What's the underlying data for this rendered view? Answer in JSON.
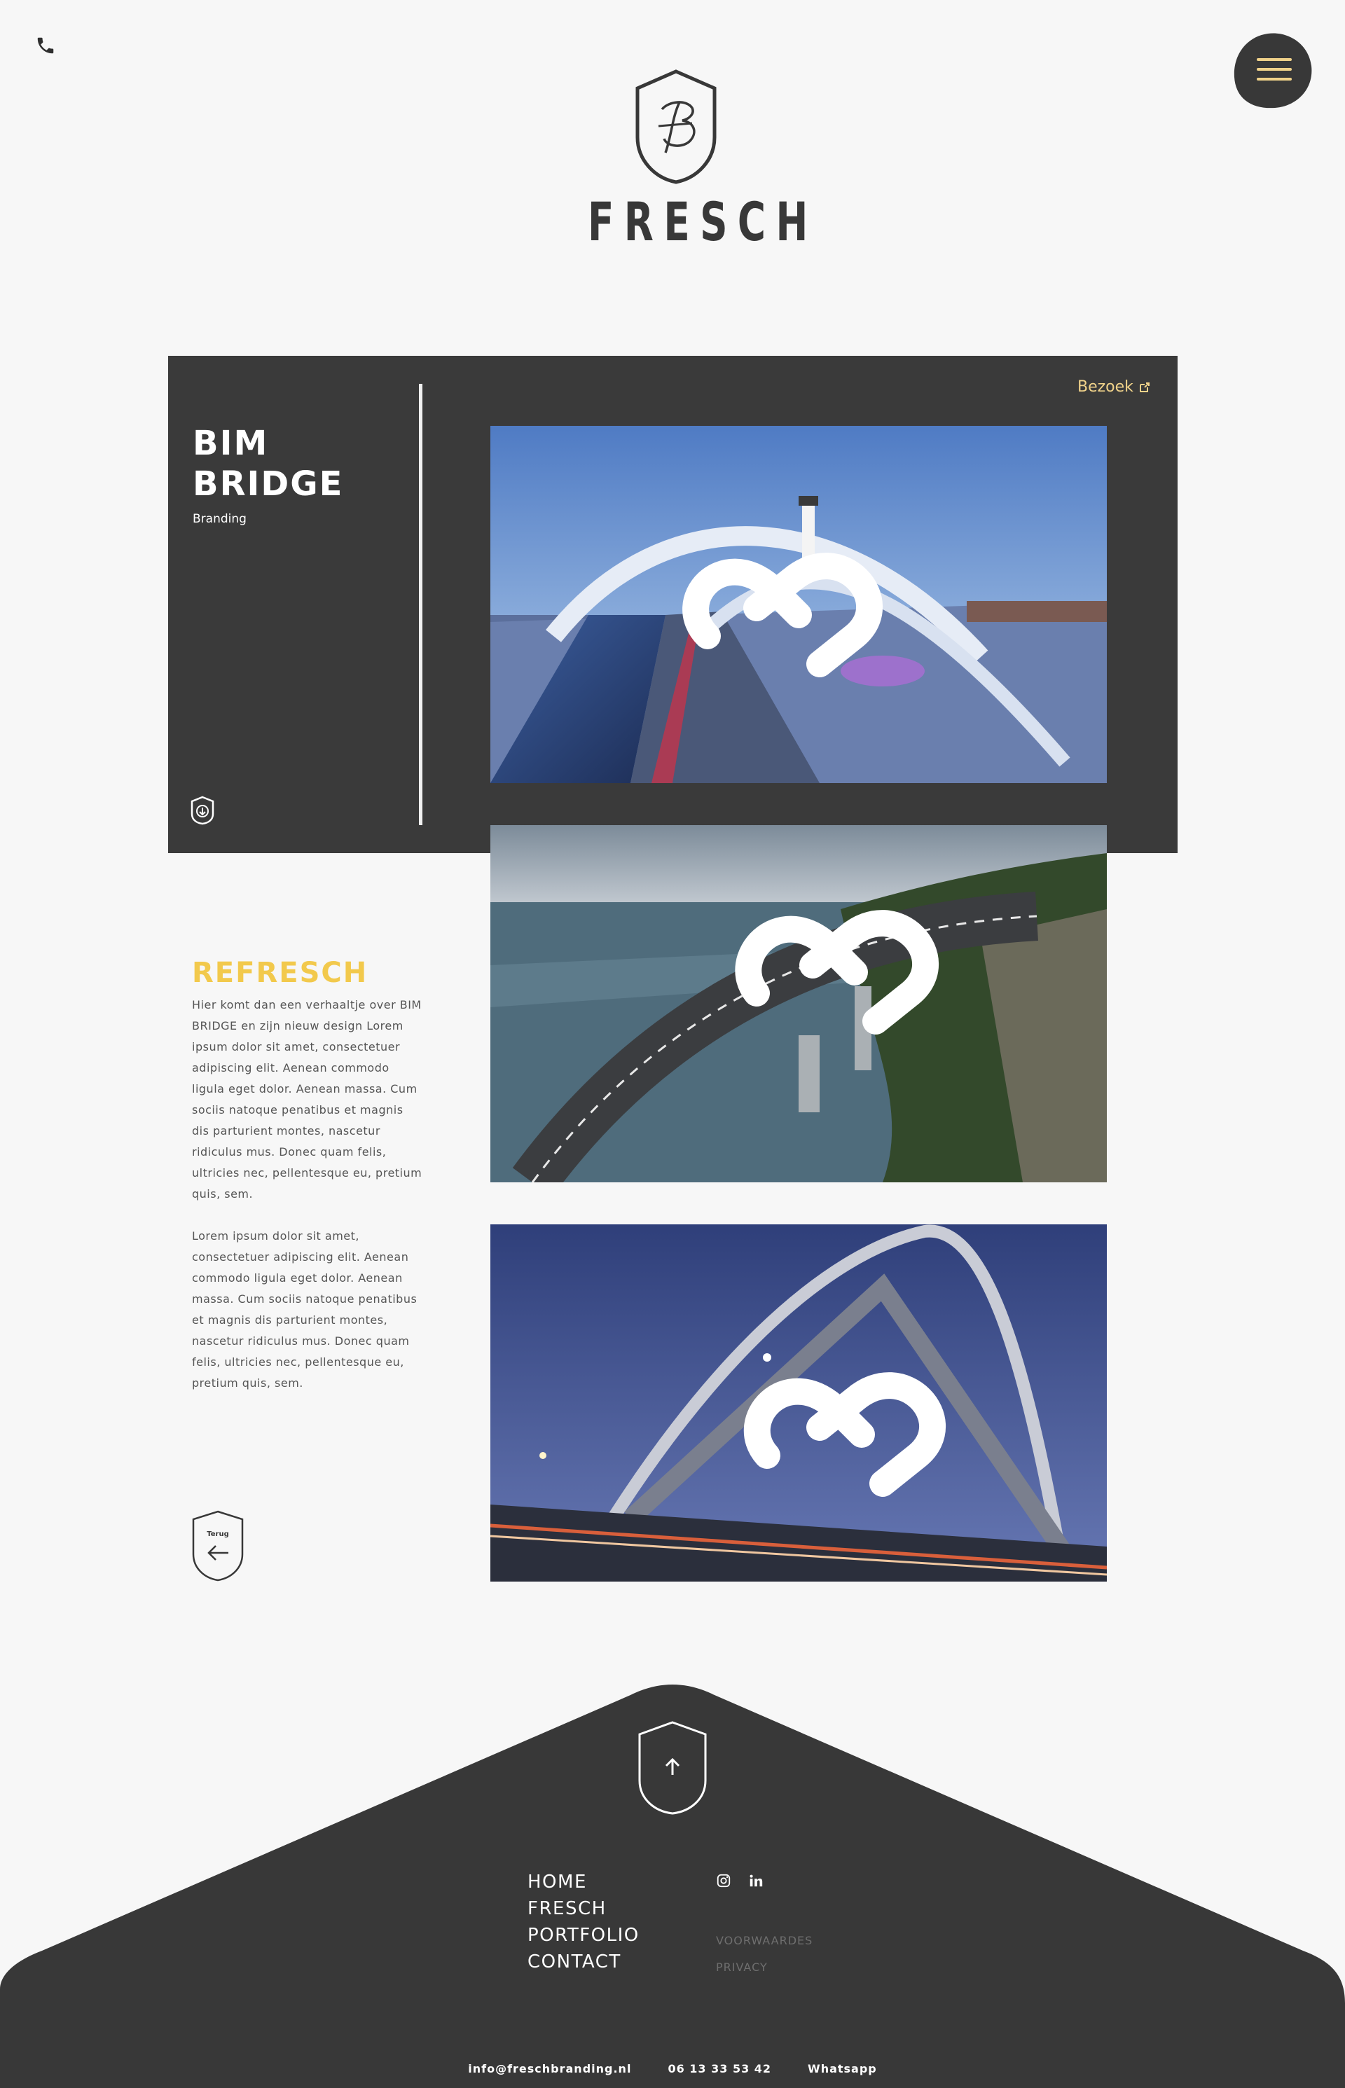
{
  "header": {
    "phone_icon": "phone-icon",
    "menu_icon": "hamburger-icon",
    "brand_monogram": "FB",
    "brand_name": "FRESCH"
  },
  "project": {
    "title_line1": "BIM",
    "title_line2": "BRIDGE",
    "category": "Branding",
    "visit_label": "Bezoek"
  },
  "story": {
    "heading": "REFRESCH",
    "paragraph1": "Hier komt dan een verhaaltje over BIM BRIDGE en zijn nieuw design Lorem ipsum dolor sit amet, consectetuer adipiscing elit. Aenean commodo ligula eget dolor. Aenean massa. Cum sociis natoque penatibus et magnis dis parturient montes, nascetur ridiculus mus. Donec quam felis, ultricies nec, pellentesque eu, pretium quis, sem.",
    "paragraph2": "Lorem ipsum dolor sit amet, consectetuer adipiscing elit. Aenean commodo ligula eget dolor. Aenean massa. Cum sociis natoque penatibus et magnis dis parturient montes, nascetur ridiculus mus. Donec quam felis, ultricies nec, pellentesque eu, pretium quis, sem.",
    "back_label": "Terug"
  },
  "footer": {
    "nav": [
      "HOME",
      "FRESCH",
      "PORTFOLIO",
      "CONTACT"
    ],
    "social": [
      "instagram-icon",
      "linkedin-icon"
    ],
    "legal": [
      "VOORWAARDES",
      "PRIVACY"
    ],
    "email": "info@freschbranding.nl",
    "phone": "06 13 33 53 42",
    "whatsapp": "Whatsapp"
  },
  "colors": {
    "dark": "#3a3a3a",
    "accent_yellow": "#f2c94c",
    "link_gold": "#f0d28a",
    "background": "#f7f7f7"
  }
}
